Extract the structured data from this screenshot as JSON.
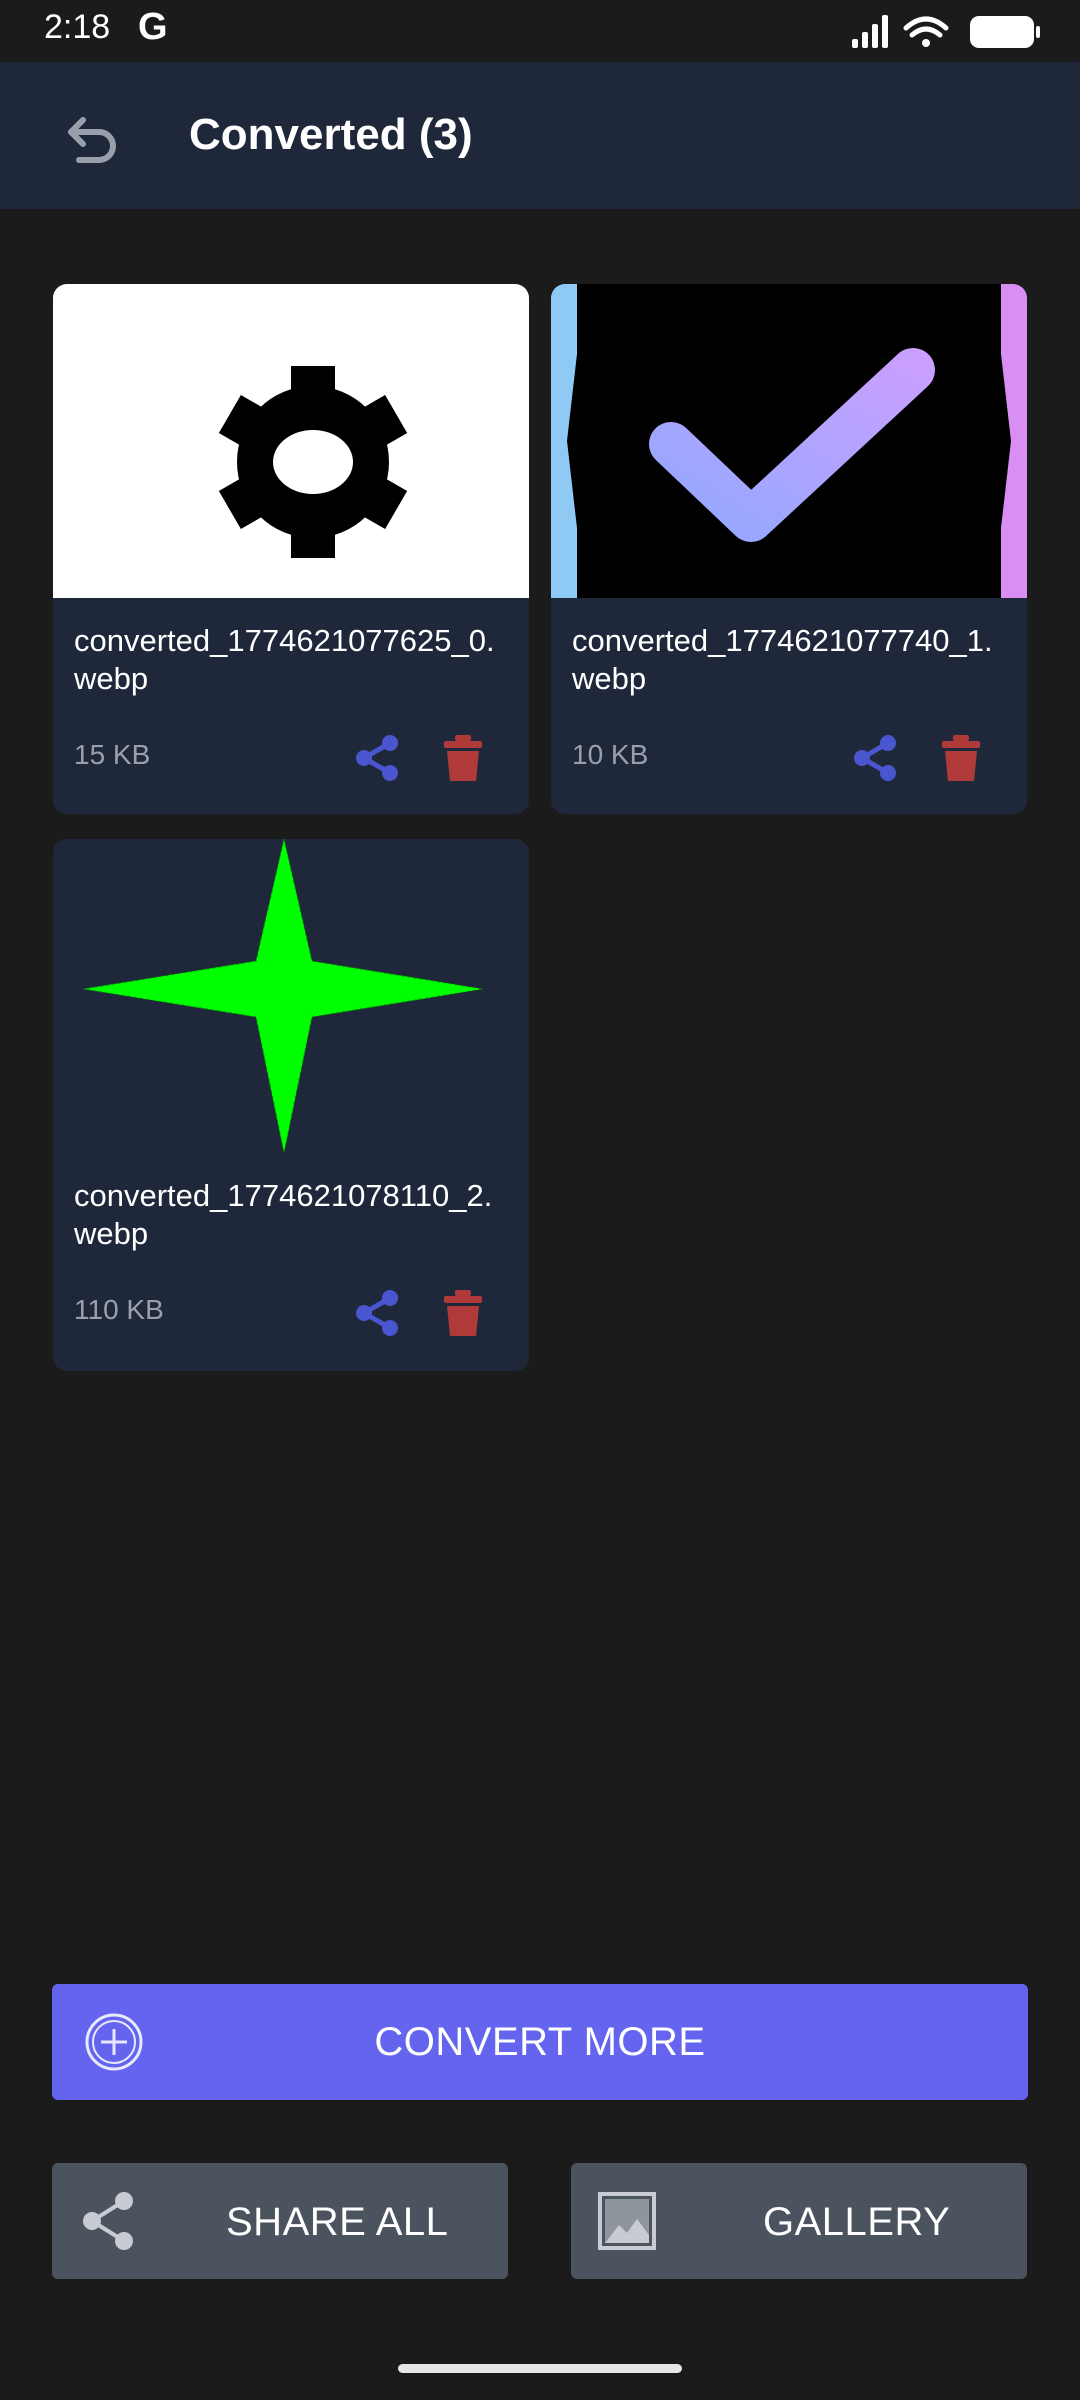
{
  "status_bar": {
    "time": "2:18",
    "g_logo": "G"
  },
  "app_bar": {
    "title": "Converted (3)",
    "back_icon": "undo-arrow-icon"
  },
  "files": [
    {
      "name": "converted_1774621077625_0.webp",
      "size": "15 KB",
      "thumbnail": "gear-image"
    },
    {
      "name": "converted_1774621077740_1.webp",
      "size": "10 KB",
      "thumbnail": "checkmark-image"
    },
    {
      "name": "converted_1774621078110_2.webp",
      "size": "110 KB",
      "thumbnail": "green-star-image"
    }
  ],
  "actions": {
    "convert_more": "CONVERT MORE",
    "share_all": "SHARE ALL",
    "gallery": "GALLERY"
  },
  "colors": {
    "background": "#1b1b1c",
    "app_bar": "#1f283a",
    "card": "#1f283a",
    "accent": "#6464ee",
    "secondary_button": "#4b535f",
    "share_icon": "#4a56d0",
    "delete_icon": "#b03a3a",
    "size_text": "#9aa0ab"
  }
}
